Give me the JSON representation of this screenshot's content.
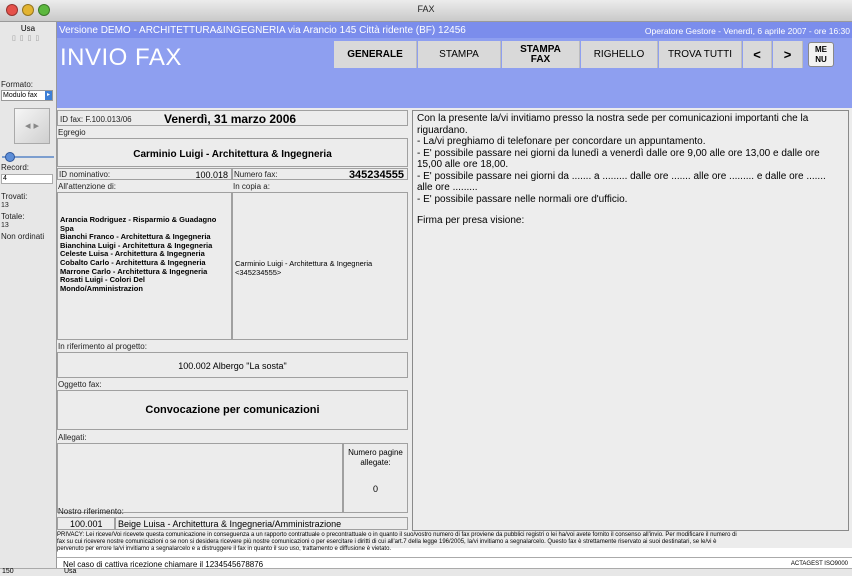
{
  "window": {
    "title": "FAX"
  },
  "left_panel": {
    "mode": "Usa",
    "format_label": "Formato:",
    "format_value": "Modulo fax",
    "record_label": "Record:",
    "record_value": "4",
    "found_label": "Trovati:",
    "found_value": "13",
    "total_label": "Totale:",
    "total_value": "13",
    "sort_status": "Non ordinati"
  },
  "header": {
    "company": "Versione DEMO - ARCHITETTURA&INGEGNERIA via Arancio 145 Città ridente (BF) 12456",
    "operator": "Operatore Gestore - Venerdì, 6 aprile 2007 - ore 16:30",
    "page_title": "INVIO FAX"
  },
  "nav": {
    "generale": "GENERALE",
    "stampa": "STAMPA",
    "stampa_fax": "STAMPA FAX",
    "righello": "RIGHELLO",
    "trova_tutti": "TROVA TUTTI",
    "prev": "<",
    "next": ">",
    "menu": "ME NU"
  },
  "form": {
    "fax_id_label": "ID fax: F.100.013/06",
    "date": "Venerdì, 31 marzo 2006",
    "egregio_label": "Egregio",
    "recipient": "Carminio Luigi - Architettura & Ingegneria",
    "nominativo_label": "ID nominativo:",
    "nominativo_value": "100.018",
    "fax_number_label": "Numero fax:",
    "fax_number_value": "345234555",
    "attention_label": "All'attenzione di:",
    "copy_label": "In copia a:",
    "attention_list": [
      "Arancia Rodriguez - Risparmio & Guadagno",
      "Spa",
      "Bianchi Franco - Architettura & Ingegneria",
      "Bianchina Luigi - Architettura & Ingegneria",
      "Celeste Luisa - Architettura & Ingegneria",
      "Cobalto Carlo - Architettura & Ingegneria",
      "Marrone Carlo - Architettura & Ingegneria",
      "Rosati Luigi - Colori Del",
      "Mondo/Amministrazion"
    ],
    "copy_list": [
      "Carminio Luigi - Architettura & Ingegneria",
      "<345234555>"
    ],
    "project_label": "In riferimento al progetto:",
    "project_value": "100.002 Albergo \"La sosta\"",
    "subject_label": "Oggetto fax:",
    "subject_value": "Convocazione per comunicazioni",
    "attachments_label": "Allegati:",
    "pages_label_1": "Numero pagine",
    "pages_label_2": "allegate:",
    "pages_value": "0",
    "our_ref_label": "Nostro riferimento:",
    "our_ref_id": "100.001",
    "our_ref_name": "Beige Luisa - Architettura & Ingegneria/Amministrazione"
  },
  "message": {
    "lines": [
      "Con la presente la/vi invitiamo presso la nostra sede per comunicazioni importanti che la",
      "riguardano.",
      "- La/vi preghiamo di telefonare per concordare un appuntamento.",
      "- E' possibile passare nei giorni da lunedì a venerdì dalle ore 9,00 alle ore 13,00 e dalle ore",
      "15,00  alle ore 18,00.",
      "- E' possibile passare nei giorni da ....... a ......... dalle ore ....... alle ore ......... e dalle ore .......",
      "alle ore .........",
      "- E' possibile passare nelle normali ore d'ufficio."
    ],
    "signature": "Firma per presa visione:"
  },
  "footer": {
    "privacy_1": "PRIVACY: Lei riceve/Voi ricevete questa comunicazione in conseguenza a un rapporto contrattuale o precontrattuale o in quanto il suo/vostro numero di fax proviene da pubblici registri o lei ha/voi avete fornito il consenso all'invio. Per modificare il numero di",
    "privacy_2": "fax su cui ricevere nostre comunicazioni o se non si desidera ricevere più nostre comunicazioni o per esercitare i diritti di cui all'art.7 della legge 196/2005, la/vi invitiamo a segnalarcelo. Questo fax è strettamente riservato ai suoi destinatari, se le/vi è",
    "privacy_3": "pervenuto per errore la/vi invitiamo a segnalarcelo e a distruggere il fax in quanto il suo uso, trattamento e diffusione è vietato.",
    "bad_reception": "Nel caso di cattiva ricezione chiamare il 1234545678876",
    "brand": "ACTAGEST ISO9000"
  },
  "statusbar": {
    "zoom": "150",
    "mode": "Usa"
  }
}
